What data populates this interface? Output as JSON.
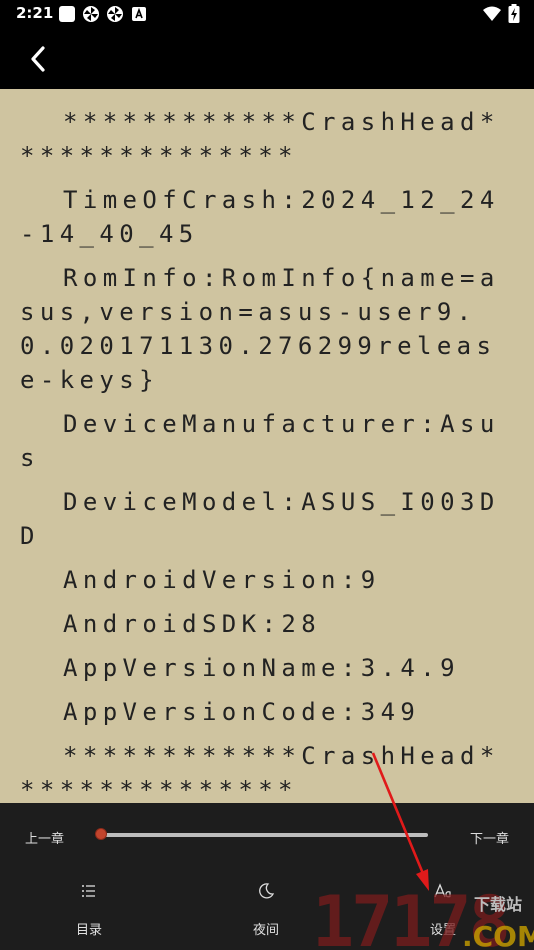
{
  "status_bar": {
    "time": "2:21",
    "icons": [
      "square-notification-icon",
      "pinwheel-icon",
      "pinwheel-icon",
      "a-box-icon"
    ],
    "right_icons": [
      "wifi-icon",
      "battery-charging-icon"
    ]
  },
  "app_bar": {
    "back_icon": "chevron-left-icon"
  },
  "reader": {
    "background": "#cfc4a0",
    "paragraphs": [
      "************CrashHead***************",
      "TimeOfCrash:2024_12_24-14_40_45",
      "RomInfo:RomInfo{name=asus,version=asus-user9.0.020171130.276299release-keys}",
      "DeviceManufacturer:Asus",
      "DeviceModel:ASUS_I003DD",
      "AndroidVersion:9",
      "AndroidSDK:28",
      "AppVersionName:3.4.9",
      "AppVersionCode:349",
      "************CrashHead***************"
    ]
  },
  "bottom": {
    "prev_chapter": "上一章",
    "next_chapter": "下一章",
    "progress": 0.0,
    "tabs": [
      {
        "label": "目录",
        "icon": "list-icon"
      },
      {
        "label": "夜间",
        "icon": "moon-icon"
      },
      {
        "label": "设置",
        "icon": "font-settings-icon"
      }
    ]
  },
  "watermark": {
    "text": "17178",
    "text2": "下载站",
    "text3": ".COM"
  },
  "colors": {
    "accent": "#c2442d",
    "arrow": "#e01a1a"
  }
}
